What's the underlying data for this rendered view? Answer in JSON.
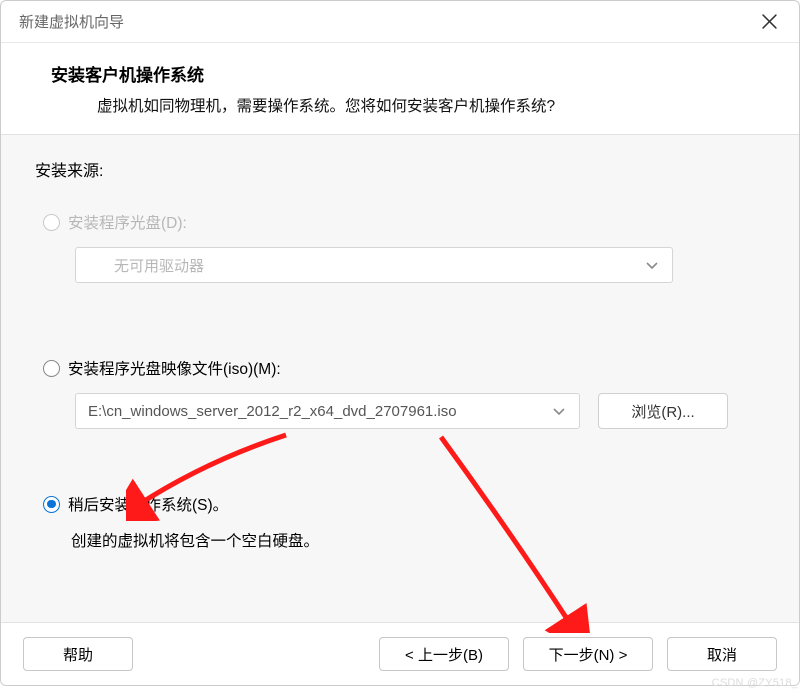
{
  "titlebar": {
    "title": "新建虚拟机向导"
  },
  "header": {
    "title": "安装客户机操作系统",
    "desc": "虚拟机如同物理机，需要操作系统。您将如何安装客户机操作系统?"
  },
  "source": {
    "label": "安装来源:",
    "disc": {
      "label": "安装程序光盘(D):",
      "dropdown": "无可用驱动器"
    },
    "iso": {
      "label": "安装程序光盘映像文件(iso)(M):",
      "path": "E:\\cn_windows_server_2012_r2_x64_dvd_2707961.iso",
      "browse": "浏览(R)..."
    },
    "later": {
      "label": "稍后安装操作系统(S)。",
      "desc": "创建的虚拟机将包含一个空白硬盘。"
    }
  },
  "footer": {
    "help": "帮助",
    "back": "< 上一步(B)",
    "next": "下一步(N) >",
    "cancel": "取消"
  },
  "watermark": "CSDN @ZY518_"
}
